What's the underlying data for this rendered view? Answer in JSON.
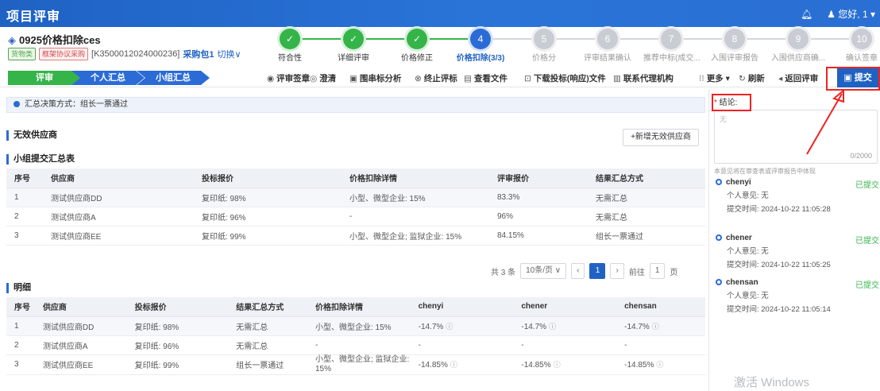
{
  "topbar": {
    "title": "项目评审",
    "greeting": "您好, 1"
  },
  "project": {
    "name": "0925价格扣除ces",
    "tag_goods": "货物类",
    "tag_method": "框架协议采购",
    "code": "[K3500012024000236]",
    "package": "采购包1",
    "switch_label": "切换"
  },
  "steps": [
    {
      "num": "✓",
      "label": "符合性",
      "state": "done"
    },
    {
      "num": "✓",
      "label": "详细评审",
      "state": "done"
    },
    {
      "num": "✓",
      "label": "价格修正",
      "state": "done"
    },
    {
      "num": "4",
      "label": "价格扣除(3/3)",
      "state": "cur"
    },
    {
      "num": "5",
      "label": "价格分",
      "state": "todo"
    },
    {
      "num": "6",
      "label": "评审结果确认",
      "state": "todo"
    },
    {
      "num": "7",
      "label": "推荐中标(成交...",
      "state": "todo"
    },
    {
      "num": "8",
      "label": "入围评审报告",
      "state": "todo"
    },
    {
      "num": "9",
      "label": "入围供应商确...",
      "state": "todo"
    },
    {
      "num": "10",
      "label": "确认签章",
      "state": "todo"
    }
  ],
  "toolbar": {
    "crumbs": [
      "评审",
      "个人汇总",
      "小组汇总"
    ],
    "buttons": [
      {
        "icon": "◉",
        "label": "评审签章"
      },
      {
        "icon": "◎",
        "label": "澄清"
      },
      {
        "icon": "▣",
        "label": "围串标分析"
      },
      {
        "icon": "⊗",
        "label": "终止评标"
      },
      {
        "icon": "▤",
        "label": "查看文件"
      },
      {
        "icon": "⊡",
        "label": "下载投标(响应)文件"
      },
      {
        "icon": "▥",
        "label": "联系代理机构"
      },
      {
        "icon": "⁝⁝",
        "label": "更多 ▾"
      },
      {
        "icon": "↻",
        "label": "刷新"
      },
      {
        "icon": "◂",
        "label": "返回评审"
      }
    ],
    "submit": "提交"
  },
  "notice": "汇总决策方式：组长一票通过",
  "invalid_section": "无效供应商",
  "add_invalid": "+新增无效供应商",
  "summary_section": "小组提交汇总表",
  "summary_table": {
    "headers": [
      "序号",
      "供应商",
      "投标报价",
      "价格扣除详情",
      "评审报价",
      "结果汇总方式"
    ],
    "rows": [
      [
        "1",
        "测试供应商DD",
        "复印纸: 98%",
        "小型、微型企业: 15%",
        "83.3%",
        "无需汇总"
      ],
      [
        "2",
        "测试供应商A",
        "复印纸: 96%",
        "-",
        "96%",
        "无需汇总"
      ],
      [
        "3",
        "测试供应商EE",
        "复印纸: 99%",
        "小型、微型企业; 监狱企业: 15%",
        "84.15%",
        "组长一票通过"
      ]
    ]
  },
  "pager": {
    "total": "共 3 条",
    "size": "10条/页",
    "page": "1",
    "goto": "前往",
    "goto_val": "1",
    "unit": "页"
  },
  "detail_section": "明细",
  "detail_table": {
    "headers": [
      "序号",
      "供应商",
      "投标报价",
      "结果汇总方式",
      "价格扣除详情",
      "chenyi",
      "chener",
      "chensan"
    ],
    "rows": [
      [
        "1",
        "测试供应商DD",
        "复印纸: 98%",
        "无需汇总",
        "小型、微型企业: 15%",
        "-14.7%",
        "-14.7%",
        "-14.7%"
      ],
      [
        "2",
        "测试供应商A",
        "复印纸: 96%",
        "无需汇总",
        "-",
        "-",
        "-",
        "-"
      ],
      [
        "3",
        "测试供应商EE",
        "复印纸: 99%",
        "组长一票通过",
        "小型、微型企业; 监狱企业: 15%",
        "-14.85%",
        "-14.85%",
        "-14.85%"
      ]
    ]
  },
  "side": {
    "conclusion_label": "结论:",
    "placeholder": "无",
    "counter": "0/2000",
    "hint": "本意见将在审查表或评审报告中体现",
    "reviewers": [
      {
        "name": "chenyi",
        "status": "已提交",
        "opinion": "个人意见: 无",
        "time": "提交时间: 2024-10-22 11:05:28"
      },
      {
        "name": "chener",
        "status": "已提交",
        "opinion": "个人意见: 无",
        "time": "提交时间: 2024-10-22 11:05:25"
      },
      {
        "name": "chensan",
        "status": "已提交",
        "opinion": "个人意见: 无",
        "time": "提交时间: 2024-10-22 11:05:14"
      }
    ]
  },
  "watermark": "激活 Windows"
}
